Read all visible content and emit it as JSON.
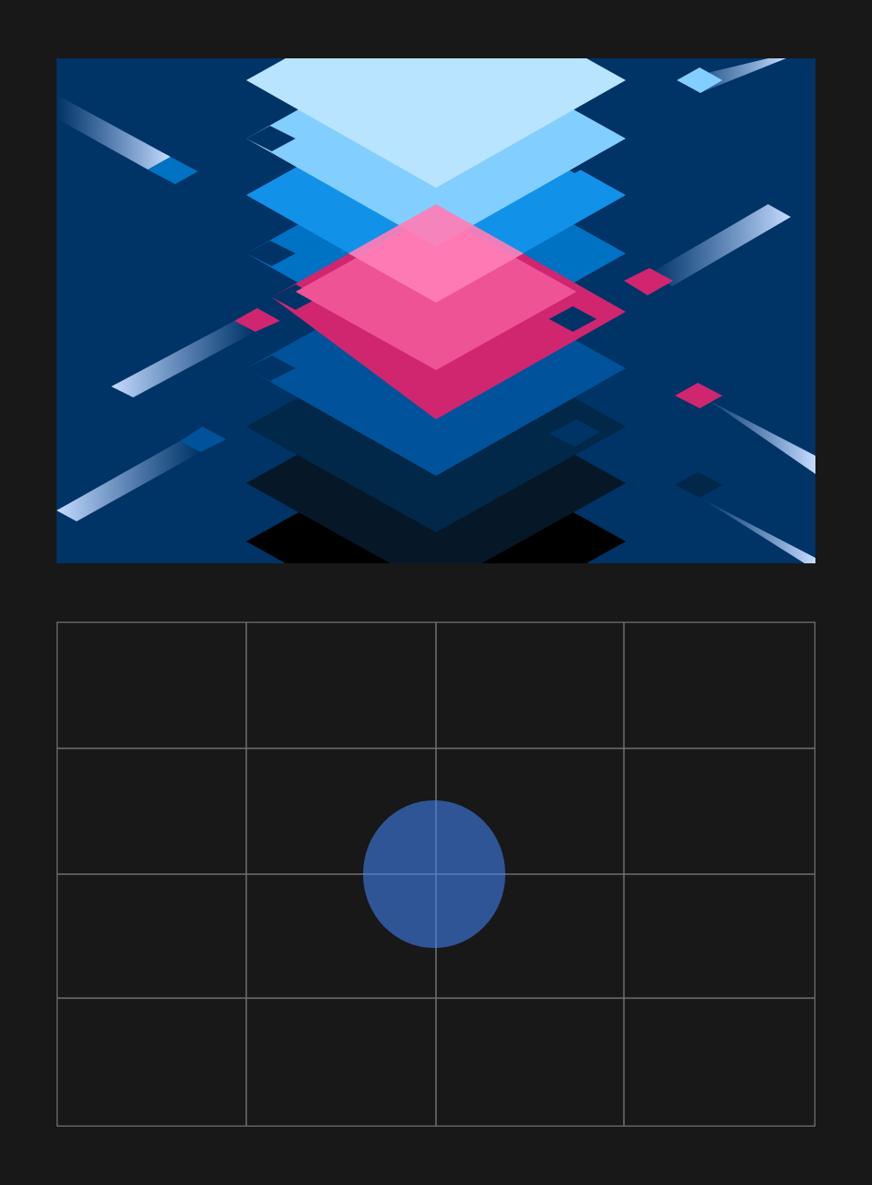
{
  "colors": {
    "page_background": "#181818",
    "hero_background": "#003366",
    "layer_lightest": "#b8e4ff",
    "layer_light": "#82cfff",
    "layer_bright": "#1192e8",
    "layer_medium": "#0072c3",
    "pink_light": "#ff7eb6",
    "pink_mid": "#ee5396",
    "pink_deep": "#d02670",
    "layer_navy": "#00539a",
    "layer_dark": "#012749",
    "layer_darker": "#061727",
    "layer_black": "#000000",
    "grid_line": "#6f6f6f",
    "focal_point": "#4589ff"
  },
  "hero": {
    "icon": "layered-diamond-artwork"
  },
  "grid": {
    "columns": 4,
    "rows": 4,
    "focal_point_icon": "focal-point-circle"
  }
}
